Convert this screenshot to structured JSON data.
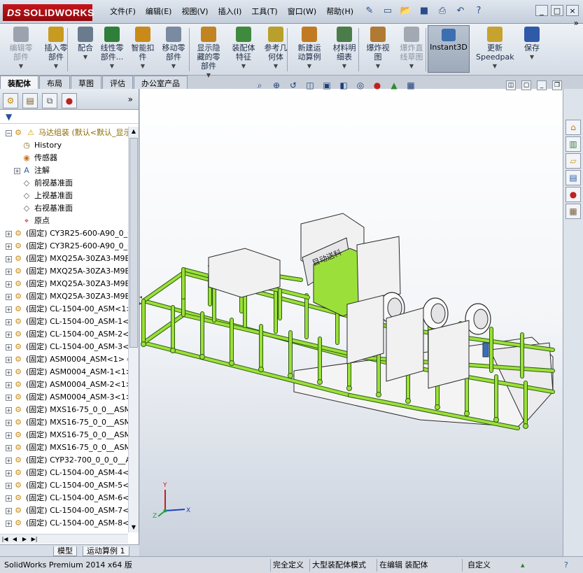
{
  "app": {
    "logo_text": "SOLIDWORKS",
    "logo_prefix": "DS"
  },
  "menu": [
    "文件(F)",
    "编辑(E)",
    "视图(V)",
    "插入(I)",
    "工具(T)",
    "窗口(W)",
    "帮助(H)"
  ],
  "quick_access_icons": [
    "pin-icon",
    "new-doc-icon",
    "open-icon",
    "save-icon",
    "print-icon",
    "undo-icon",
    "help-icon"
  ],
  "window_controls": [
    "_",
    "□",
    "×"
  ],
  "commands": [
    {
      "label": "编辑零\n部件",
      "icon": "edit-component-icon",
      "color": "#9aa3ae",
      "enabled": false
    },
    {
      "label": "插入零\n部件",
      "icon": "insert-component-icon",
      "color": "#c89a20",
      "enabled": true
    },
    {
      "label": "配合",
      "icon": "mate-icon",
      "color": "#6b7b8e",
      "enabled": true
    },
    {
      "label": "线性零\n部件...",
      "icon": "linear-pattern-icon",
      "color": "#2f7f3a",
      "enabled": true
    },
    {
      "label": "智能扣\n件",
      "icon": "smart-fastener-icon",
      "color": "#c98a1a",
      "enabled": true
    },
    {
      "label": "移动零\n部件",
      "icon": "move-component-icon",
      "color": "#7a8aa0",
      "enabled": true
    },
    {
      "label": "显示隐\n藏的零\n部件",
      "icon": "show-hidden-icon",
      "color": "#c28420",
      "enabled": true
    },
    {
      "label": "装配体\n特征",
      "icon": "assembly-feature-icon",
      "color": "#3f8a3f",
      "enabled": true
    },
    {
      "label": "参考几\n何体",
      "icon": "reference-geometry-icon",
      "color": "#b9a02a",
      "enabled": true
    },
    {
      "label": "新建运\n动算例",
      "icon": "new-motion-study-icon",
      "color": "#c27a22",
      "enabled": true
    },
    {
      "label": "材料明\n细表",
      "icon": "bom-icon",
      "color": "#4b7d4b",
      "enabled": true
    },
    {
      "label": "爆炸视\n图",
      "icon": "exploded-view-icon",
      "color": "#b07a32",
      "enabled": true
    },
    {
      "label": "爆炸直\n线草图",
      "icon": "explode-line-sketch-icon",
      "color": "#a3a9b2",
      "enabled": false
    },
    {
      "label": "Instant3D",
      "icon": "instant3d-icon",
      "color": "#3b6fb0",
      "enabled": true
    },
    {
      "label": "更新\nSpeedpak",
      "icon": "speedpak-icon",
      "color": "#c8a22e",
      "enabled": true
    },
    {
      "label": "保存",
      "icon": "save-icon",
      "color": "#2f5aa8",
      "enabled": true
    }
  ],
  "command_tabs": [
    "装配体",
    "布局",
    "草图",
    "评估",
    "办公室产品"
  ],
  "hud_icons": [
    "zoom-to-fit-icon",
    "zoom-area-icon",
    "previous-view-icon",
    "section-view-icon",
    "view-orientation-icon",
    "display-style-icon",
    "hide-show-icon",
    "edit-appearance-icon",
    "apply-scene-icon",
    "view-settings-icon"
  ],
  "panel_tabs": [
    "featuremanager-icon",
    "propertymanager-icon",
    "configurationmanager-icon",
    "displaymanager-icon"
  ],
  "tree": {
    "root": "马达组装  (默认<默认_显示",
    "items": [
      {
        "label": "History",
        "icon": "history-icon",
        "expand": false
      },
      {
        "label": "传感器",
        "icon": "sensor-icon",
        "expand": false
      },
      {
        "label": "注解",
        "icon": "annotation-icon",
        "expand": true
      },
      {
        "label": "前视基准面",
        "icon": "plane-icon",
        "expand": false
      },
      {
        "label": "上视基准面",
        "icon": "plane-icon",
        "expand": false
      },
      {
        "label": "右视基准面",
        "icon": "plane-icon",
        "expand": false
      },
      {
        "label": "原点",
        "icon": "origin-icon",
        "expand": false
      },
      {
        "label": "(固定) CY3R25-600-A90_0_0",
        "icon": "part-icon",
        "expand": true
      },
      {
        "label": "(固定) CY3R25-600-A90_0_0",
        "icon": "part-icon",
        "expand": true
      },
      {
        "label": "(固定) MXQ25A-30ZA3-M9BV",
        "icon": "part-icon",
        "expand": true
      },
      {
        "label": "(固定) MXQ25A-30ZA3-M9BV",
        "icon": "part-icon",
        "expand": true
      },
      {
        "label": "(固定) MXQ25A-30ZA3-M9BV",
        "icon": "part-icon",
        "expand": true
      },
      {
        "label": "(固定) MXQ25A-30ZA3-M9BV",
        "icon": "part-icon",
        "expand": true
      },
      {
        "label": "(固定) CL-1504-00_ASM<1>",
        "icon": "part-icon",
        "expand": true
      },
      {
        "label": "(固定) CL-1504-00_ASM-1<1",
        "icon": "part-icon",
        "expand": true
      },
      {
        "label": "(固定) CL-1504-00_ASM-2<",
        "icon": "part-icon",
        "expand": true
      },
      {
        "label": "(固定) CL-1504-00_ASM-3<",
        "icon": "part-icon",
        "expand": true
      },
      {
        "label": "(固定) ASM0004_ASM<1> (5",
        "icon": "part-icon",
        "expand": true
      },
      {
        "label": "(固定) ASM0004_ASM-1<1>",
        "icon": "part-icon",
        "expand": true
      },
      {
        "label": "(固定) ASM0004_ASM-2<1>",
        "icon": "part-icon",
        "expand": true
      },
      {
        "label": "(固定) ASM0004_ASM-3<1>",
        "icon": "part-icon",
        "expand": true
      },
      {
        "label": "(固定) MXS16-75_0_0__ASM",
        "icon": "part-icon",
        "expand": true
      },
      {
        "label": "(固定) MXS16-75_0_0__ASM",
        "icon": "part-icon",
        "expand": true
      },
      {
        "label": "(固定) MXS16-75_0_0__ASM",
        "icon": "part-icon",
        "expand": true
      },
      {
        "label": "(固定) MXS16-75_0_0__ASM",
        "icon": "part-icon",
        "expand": true
      },
      {
        "label": "(固定) CYP32-700_0_0_0__A",
        "icon": "part-icon",
        "expand": true
      },
      {
        "label": "(固定) CL-1504-00_ASM-4<",
        "icon": "part-icon",
        "expand": true
      },
      {
        "label": "(固定) CL-1504-00_ASM-5<",
        "icon": "part-icon",
        "expand": true
      },
      {
        "label": "(固定) CL-1504-00_ASM-6<",
        "icon": "part-icon",
        "expand": true
      },
      {
        "label": "(固定) CL-1504-00_ASM-7<",
        "icon": "part-icon",
        "expand": true
      },
      {
        "label": "(固定) CL-1504-00_ASM-8<",
        "icon": "part-icon",
        "expand": true
      }
    ]
  },
  "bottom_tabs": [
    "模型",
    "运动算例 1"
  ],
  "model_label": "目动送料",
  "triad": {
    "x": "X",
    "y": "Y",
    "z": "Z"
  },
  "task_pane_icons": [
    "home-icon",
    "design-library-icon",
    "file-explorer-icon",
    "view-palette-icon",
    "appearances-icon",
    "custom-properties-icon"
  ],
  "colors": {
    "frame_green": "#9be03a",
    "frame_outline": "#2d5a10",
    "block_fill": "#f1f1f2",
    "block_outline": "#2b2b2b"
  },
  "status": {
    "product": "SolidWorks Premium 2014 x64 版",
    "defined": "完全定义",
    "mode": "大型装配体模式",
    "editing": "在编辑 装配体",
    "units": "自定义"
  }
}
